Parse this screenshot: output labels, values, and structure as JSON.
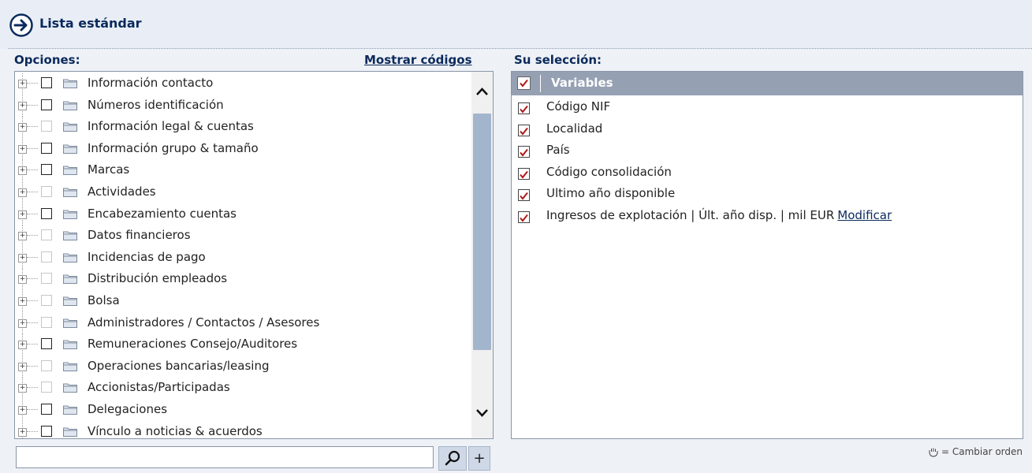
{
  "header": {
    "title": "Lista estándar"
  },
  "options": {
    "label": "Opciones:",
    "show_codes": "Mostrar códigos",
    "items": [
      {
        "label": "Información contacto",
        "enabled": true
      },
      {
        "label": "Números identificación",
        "enabled": true
      },
      {
        "label": "Información legal & cuentas",
        "enabled": false
      },
      {
        "label": "Información grupo & tamaño",
        "enabled": true
      },
      {
        "label": "Marcas",
        "enabled": true
      },
      {
        "label": "Actividades",
        "enabled": false
      },
      {
        "label": "Encabezamiento cuentas",
        "enabled": true
      },
      {
        "label": "Datos financieros",
        "enabled": false
      },
      {
        "label": "Incidencias de pago",
        "enabled": false
      },
      {
        "label": "Distribución empleados",
        "enabled": false
      },
      {
        "label": "Bolsa",
        "enabled": false
      },
      {
        "label": "Administradores / Contactos / Asesores",
        "enabled": false
      },
      {
        "label": "Remuneraciones Consejo/Auditores",
        "enabled": true
      },
      {
        "label": "Operaciones bancarias/leasing",
        "enabled": false
      },
      {
        "label": "Accionistas/Participadas",
        "enabled": false
      },
      {
        "label": "Delegaciones",
        "enabled": true
      },
      {
        "label": "Vínculo a noticias & acuerdos",
        "enabled": true
      }
    ]
  },
  "search": {
    "value": "",
    "plus": "+"
  },
  "selection": {
    "label": "Su selección:",
    "header": "Variables",
    "items": [
      {
        "label": "Código NIF"
      },
      {
        "label": "Localidad"
      },
      {
        "label": "País"
      },
      {
        "label": "Código consolidación"
      },
      {
        "label": "Ultimo año disponible"
      },
      {
        "label": "Ingresos de explotación | Últ. año disp. | mil EUR",
        "link": "Modificar"
      }
    ]
  },
  "change_order": "= Cambiar orden",
  "colors": {
    "accent": "#0b2a5c",
    "check": "#b01818",
    "header_bar": "#96a0b3",
    "scroll_thumb": "#a3b5cd"
  }
}
